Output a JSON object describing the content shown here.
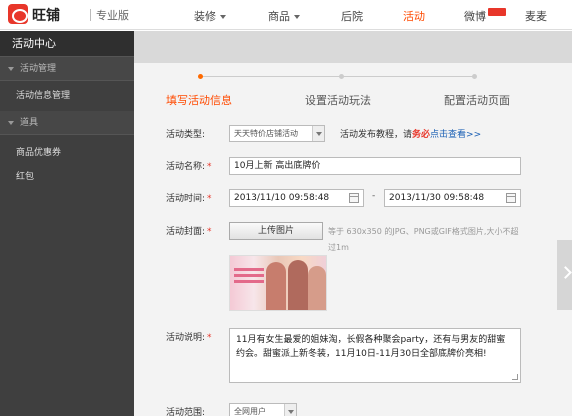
{
  "header": {
    "logo_text": "旺铺",
    "edition": "专业版",
    "nav": [
      {
        "label": "装修",
        "has_caret": true
      },
      {
        "label": "商品",
        "has_caret": true
      },
      {
        "label": "后院",
        "has_caret": false
      },
      {
        "label": "活动",
        "has_caret": false,
        "active": true
      },
      {
        "label": "微博",
        "has_caret": false
      },
      {
        "label": "麦麦",
        "has_caret": false
      }
    ],
    "accent_color": "#ff4a00"
  },
  "sidebar": {
    "title": "活动中心",
    "groups": [
      {
        "label": "活动管理",
        "items": [
          "活动信息管理"
        ]
      },
      {
        "label": "道具",
        "items": [
          "商品优惠券",
          "红包"
        ]
      }
    ]
  },
  "steps": [
    {
      "label": "填写活动信息",
      "active": true
    },
    {
      "label": "设置活动玩法",
      "active": false
    },
    {
      "label": "配置活动页面",
      "active": false
    }
  ],
  "form": {
    "type_label": "活动类型:",
    "type_value": "天天特价店铺活动",
    "tutorial_prefix": "活动发布教程，请",
    "tutorial_emph": "务必",
    "tutorial_link": "点击查看>>",
    "name_label": "活动名称:",
    "name_value": "10月上新 高出底牌价",
    "time_label": "活动时间:",
    "start_time": "2013/11/10 09:58:48",
    "time_sep": "-",
    "end_time": "2013/11/30 09:58:48",
    "cover_label": "活动封面:",
    "upload_button": "上传图片",
    "cover_hint": "等于 630x350 的JPG、PNG或GIF格式图片,大小不超过1m",
    "desc_label": "活动说明:",
    "desc_value": "11月有女生最爱的姐妹淘，长假各种聚会party，还有与男友的甜蜜约会。甜蜜派上新冬装，11月10日-11月30日全部底牌价亮相!",
    "scope_label": "活动范围:",
    "scope_value": "全网用户"
  }
}
